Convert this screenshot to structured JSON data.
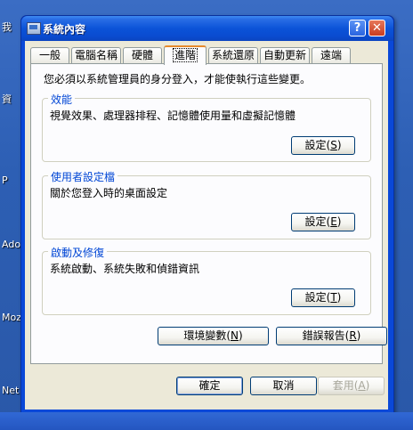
{
  "desktop": {
    "labels": [
      "我",
      "資",
      "P",
      "Ado",
      "Moz",
      "Net"
    ]
  },
  "window": {
    "title": "系統內容",
    "help_glyph": "?",
    "close_glyph": "✕"
  },
  "tabs": [
    {
      "label": "一般"
    },
    {
      "label": "電腦名稱"
    },
    {
      "label": "硬體"
    },
    {
      "label": "進階"
    },
    {
      "label": "系統還原"
    },
    {
      "label": "自動更新"
    },
    {
      "label": "遠端"
    }
  ],
  "panel": {
    "intro": "您必須以系統管理員的身分登入，才能使執行這些變更。",
    "groups": [
      {
        "title": "效能",
        "desc": "視覺效果、處理器排程、記憶體使用量和虛擬記憶體",
        "button": "設定(",
        "key": "S",
        "end": ")"
      },
      {
        "title": "使用者設定檔",
        "desc": "關於您登入時的桌面設定",
        "button": "設定(",
        "key": "E",
        "end": ")"
      },
      {
        "title": "啟動及修復",
        "desc": "系統啟動、系統失敗和偵錯資訊",
        "button": "設定(",
        "key": "T",
        "end": ")"
      }
    ],
    "env_button": {
      "label": "環境變數(",
      "key": "N",
      "end": ")"
    },
    "error_button": {
      "label": "錯誤報告(",
      "key": "R",
      "end": ")"
    }
  },
  "footer": {
    "ok": "確定",
    "cancel": "取消",
    "apply": "套用(",
    "apply_key": "A",
    "apply_end": ")"
  }
}
